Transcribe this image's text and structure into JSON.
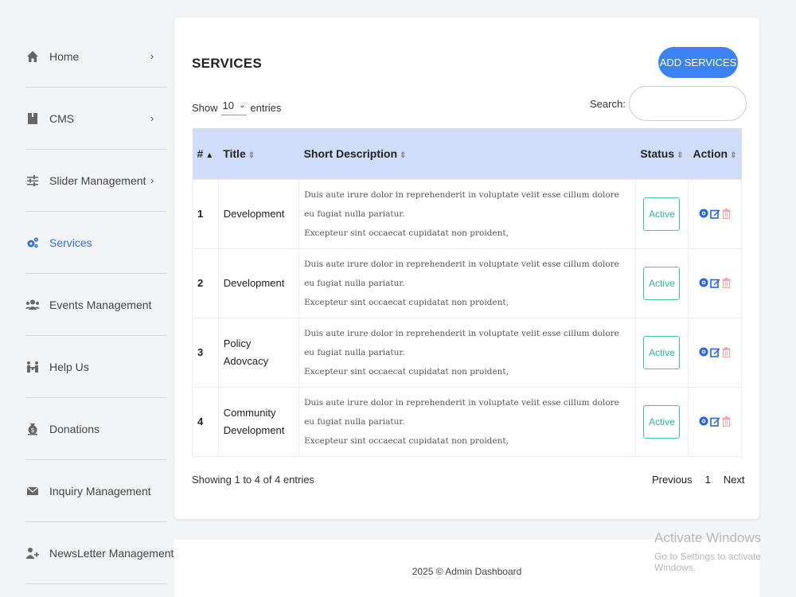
{
  "sidebar": {
    "items": [
      {
        "label": "Home",
        "icon": "home-icon",
        "chevron": "›"
      },
      {
        "label": "CMS",
        "icon": "document-icon",
        "chevron": "›"
      },
      {
        "label": "Slider Management",
        "icon": "sliders-icon",
        "chevron": "›"
      },
      {
        "label": "Services",
        "icon": "gears-icon",
        "chevron": ""
      },
      {
        "label": "Events Management",
        "icon": "users-icon",
        "chevron": ""
      },
      {
        "label": "Help Us",
        "icon": "people-icon",
        "chevron": ""
      },
      {
        "label": "Donations",
        "icon": "money-bag-icon",
        "chevron": ""
      },
      {
        "label": "Inquiry Management",
        "icon": "envelope-icon",
        "chevron": ""
      },
      {
        "label": "NewsLetter Management",
        "icon": "user-plus-icon",
        "chevron": ""
      }
    ],
    "active_color": "#2f6fe4"
  },
  "main": {
    "title": "SERVICES",
    "add_button": "ADD SERVICES",
    "length": {
      "show": "Show",
      "value": "10",
      "entries": "entries"
    },
    "search": {
      "label": "Search:",
      "value": "",
      "placeholder": ""
    },
    "table": {
      "headers": [
        "#",
        "Title",
        "Short Description",
        "Status",
        "Action"
      ],
      "rows": [
        {
          "num": "1",
          "title": "Development",
          "desc1": "Duis aute irure dolor in reprehenderit in voluptate velit esse cillum dolore eu fugiat nulla pariatur.",
          "desc2": "Excepteur sint occaecat cupidatat non proident,",
          "status": "Active"
        },
        {
          "num": "2",
          "title": "Development",
          "desc1": "Duis aute irure dolor in reprehenderit in voluptate velit esse cillum dolore eu fugiat nulla pariatur.",
          "desc2": "Excepteur sint occaecat cupidatat non proident,",
          "status": "Active"
        },
        {
          "num": "3",
          "title": "Policy Adovcacy",
          "desc1": "Duis aute irure dolor in reprehenderit in voluptate velit esse cillum dolore eu fugiat nulla pariatur.",
          "desc2": "Excepteur sint occaecat cupidatat non proident,",
          "status": "Active"
        },
        {
          "num": "4",
          "title": "Community Development",
          "desc1": "Duis aute irure dolor in reprehenderit in voluptate velit esse cillum dolore eu fugiat nulla pariatur.",
          "desc2": "Excepteur sint occaecat cupidatat non proident,",
          "status": "Active"
        }
      ]
    },
    "info": "Showing 1 to 4 of 4 entries",
    "pagination": {
      "previous": "Previous",
      "page": "1",
      "next": "Next"
    }
  },
  "footer": {
    "text": "2025 © Admin Dashboard"
  },
  "watermark": {
    "line1": "Activate Windows",
    "line2": "Go to Settings to activate Windows."
  },
  "colors": {
    "header_bg": "#cfddfb",
    "accent": "#3b82f6",
    "status": "#2bb79a",
    "delete": "#f4a3a8"
  }
}
